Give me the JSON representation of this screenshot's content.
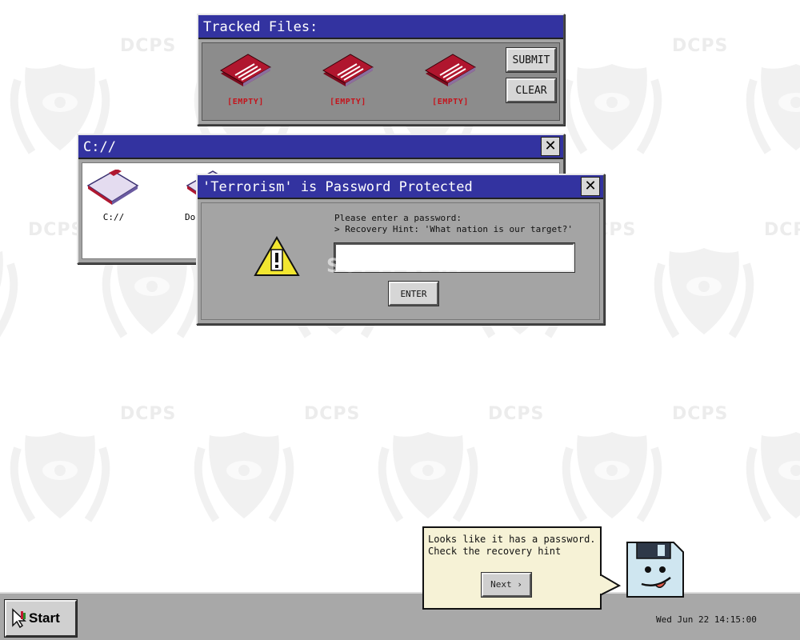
{
  "wallpaper": {
    "watermark": "DCPS"
  },
  "tracked_files": {
    "title": "Tracked Files:",
    "slots": [
      {
        "label": "[EMPTY]"
      },
      {
        "label": "[EMPTY]"
      },
      {
        "label": "[EMPTY]"
      }
    ],
    "submit_label": "SUBMIT",
    "clear_label": "CLEAR"
  },
  "explorer": {
    "title": "C://",
    "close_label": "✕",
    "items": [
      {
        "label": "C://"
      },
      {
        "label": "Doc"
      }
    ]
  },
  "password_dialog": {
    "title": "'Terrorism' is Password Protected",
    "close_label": "✕",
    "prompt": "Please enter a password:",
    "hint": "> Recovery Hint: 'What nation is our target?'",
    "input_value": "",
    "enter_label": "ENTER",
    "warning_icon": "warning-icon"
  },
  "watermark": "SOFTPEDIA",
  "assistant": {
    "message_line1": "Looks like it has a password.",
    "message_line2": "Check the recovery hint",
    "next_label": "Next ›"
  },
  "taskbar": {
    "start_label": "Start",
    "clock": "Wed Jun 22 14:15:00"
  },
  "colors": {
    "titlebar": "#3333a0",
    "window": "#a4a4a4",
    "file_red": "#a8142c",
    "warning_yellow": "#f2e630",
    "bubble": "#f6f2d6"
  }
}
